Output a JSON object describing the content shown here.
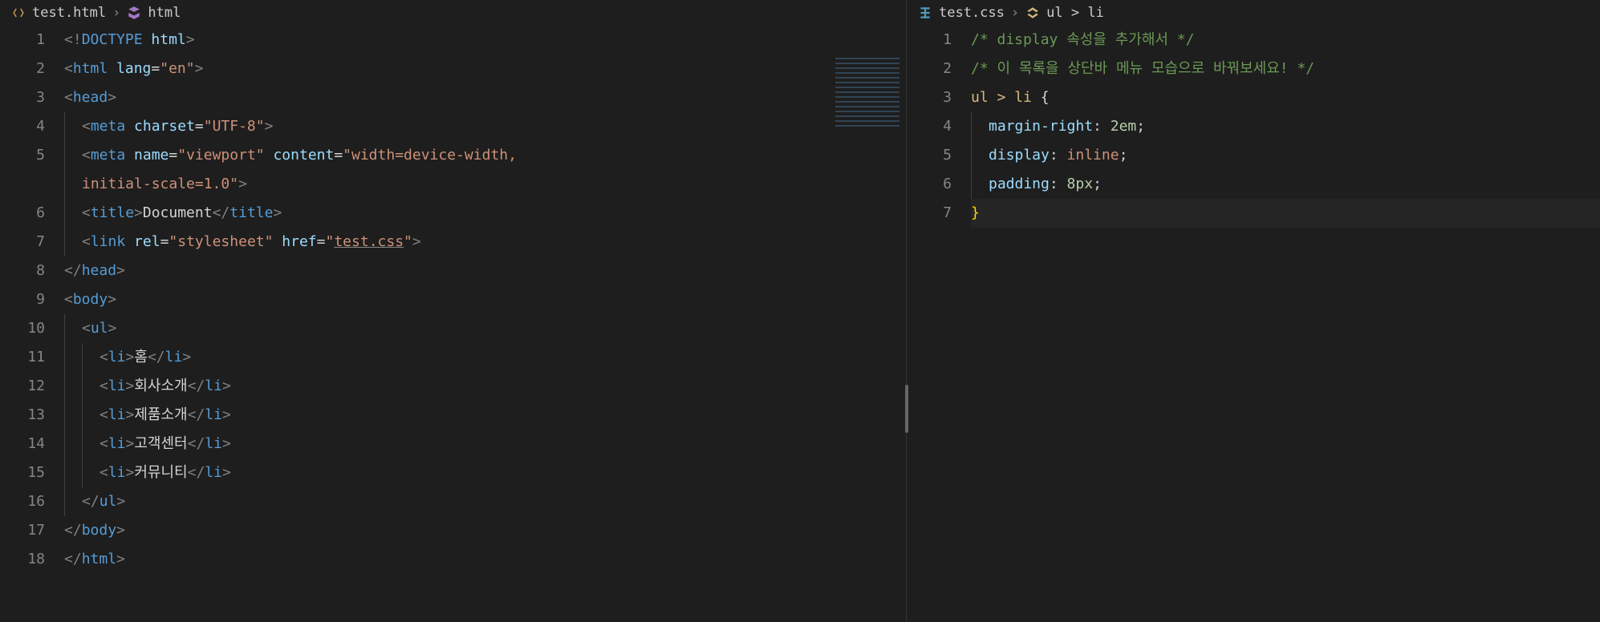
{
  "left": {
    "breadcrumb": {
      "file": "test.html",
      "symbol": "html"
    },
    "lines": [
      {
        "n": "1",
        "html": "<span class='tag-bracket'>&lt;!</span><span class='doctype'>DOCTYPE</span> <span class='attr-name'>html</span><span class='tag-bracket'>&gt;</span>"
      },
      {
        "n": "2",
        "html": "<span class='tag-bracket'>&lt;</span><span class='tag-name'>html</span> <span class='attr-name'>lang</span>=<span class='attr-val'>\"en\"</span><span class='tag-bracket'>&gt;</span>"
      },
      {
        "n": "3",
        "html": "<span class='tag-bracket'>&lt;</span><span class='tag-name'>head</span><span class='tag-bracket'>&gt;</span>"
      },
      {
        "n": "4",
        "html": "  <span class='tag-bracket'>&lt;</span><span class='tag-name'>meta</span> <span class='attr-name'>charset</span>=<span class='attr-val'>\"UTF-8\"</span><span class='tag-bracket'>&gt;</span>"
      },
      {
        "n": "5",
        "html": "  <span class='tag-bracket'>&lt;</span><span class='tag-name'>meta</span> <span class='attr-name'>name</span>=<span class='attr-val'>\"viewport\"</span> <span class='attr-name'>content</span>=<span class='attr-val'>\"width=device-width, </span>"
      },
      {
        "n": "",
        "html": "  <span class='attr-val'>initial-scale=1.0\"</span><span class='tag-bracket'>&gt;</span>"
      },
      {
        "n": "6",
        "html": "  <span class='tag-bracket'>&lt;</span><span class='tag-name'>title</span><span class='tag-bracket'>&gt;</span><span class='text'>Document</span><span class='tag-bracket'>&lt;/</span><span class='tag-name'>title</span><span class='tag-bracket'>&gt;</span>"
      },
      {
        "n": "7",
        "html": "  <span class='tag-bracket'>&lt;</span><span class='tag-name'>link</span> <span class='attr-name'>rel</span>=<span class='attr-val'>\"stylesheet\"</span> <span class='attr-name'>href</span>=<span class='attr-val'>\"<span class='link-underline'>test.css</span>\"</span><span class='tag-bracket'>&gt;</span>"
      },
      {
        "n": "8",
        "html": "<span class='tag-bracket'>&lt;/</span><span class='tag-name'>head</span><span class='tag-bracket'>&gt;</span>"
      },
      {
        "n": "9",
        "html": "<span class='tag-bracket'>&lt;</span><span class='tag-name'>body</span><span class='tag-bracket'>&gt;</span>"
      },
      {
        "n": "10",
        "html": "  <span class='tag-bracket'>&lt;</span><span class='tag-name'>ul</span><span class='tag-bracket'>&gt;</span>"
      },
      {
        "n": "11",
        "html": "    <span class='tag-bracket'>&lt;</span><span class='tag-name'>li</span><span class='tag-bracket'>&gt;</span><span class='text'>홈</span><span class='tag-bracket'>&lt;/</span><span class='tag-name'>li</span><span class='tag-bracket'>&gt;</span>"
      },
      {
        "n": "12",
        "html": "    <span class='tag-bracket'>&lt;</span><span class='tag-name'>li</span><span class='tag-bracket'>&gt;</span><span class='text'>회사소개</span><span class='tag-bracket'>&lt;/</span><span class='tag-name'>li</span><span class='tag-bracket'>&gt;</span>"
      },
      {
        "n": "13",
        "html": "    <span class='tag-bracket'>&lt;</span><span class='tag-name'>li</span><span class='tag-bracket'>&gt;</span><span class='text'>제품소개</span><span class='tag-bracket'>&lt;/</span><span class='tag-name'>li</span><span class='tag-bracket'>&gt;</span>"
      },
      {
        "n": "14",
        "html": "    <span class='tag-bracket'>&lt;</span><span class='tag-name'>li</span><span class='tag-bracket'>&gt;</span><span class='text'>고객센터</span><span class='tag-bracket'>&lt;/</span><span class='tag-name'>li</span><span class='tag-bracket'>&gt;</span>"
      },
      {
        "n": "15",
        "html": "    <span class='tag-bracket'>&lt;</span><span class='tag-name'>li</span><span class='tag-bracket'>&gt;</span><span class='text'>커뮤니티</span><span class='tag-bracket'>&lt;/</span><span class='tag-name'>li</span><span class='tag-bracket'>&gt;</span>"
      },
      {
        "n": "16",
        "html": "  <span class='tag-bracket'>&lt;/</span><span class='tag-name'>ul</span><span class='tag-bracket'>&gt;</span>"
      },
      {
        "n": "17",
        "html": "<span class='tag-bracket'>&lt;/</span><span class='tag-name'>body</span><span class='tag-bracket'>&gt;</span>"
      },
      {
        "n": "18",
        "html": "<span class='tag-bracket'>&lt;/</span><span class='tag-name'>html</span><span class='tag-bracket'>&gt;</span>"
      }
    ]
  },
  "right": {
    "breadcrumb": {
      "file": "test.css",
      "symbol": "ul > li"
    },
    "currentLineIndex": 6,
    "lines": [
      {
        "n": "1",
        "html": "<span class='comment'>/* display 속성을 추가해서 */</span>"
      },
      {
        "n": "2",
        "html": "<span class='comment'>/* 이 목록을 상단바 메뉴 모습으로 바꿔보세요! */</span>"
      },
      {
        "n": "3",
        "html": "<span class='selector'>ul</span> <span class='selector'>&gt;</span> <span class='selector'>li</span> <span class='brace'>{</span>"
      },
      {
        "n": "4",
        "html": "  <span class='prop'>margin-right</span><span class='colon'>:</span> <span class='num'>2em</span><span class='colon'>;</span>"
      },
      {
        "n": "5",
        "html": "  <span class='prop'>display</span><span class='colon'>:</span> <span class='value'>inline</span><span class='colon'>;</span>"
      },
      {
        "n": "6",
        "html": "  <span class='prop'>padding</span><span class='colon'>:</span> <span class='num'>8px</span><span class='colon'>;</span>"
      },
      {
        "n": "7",
        "html": "<span class='brace' style='color:#ffd700'>}</span>"
      }
    ]
  }
}
